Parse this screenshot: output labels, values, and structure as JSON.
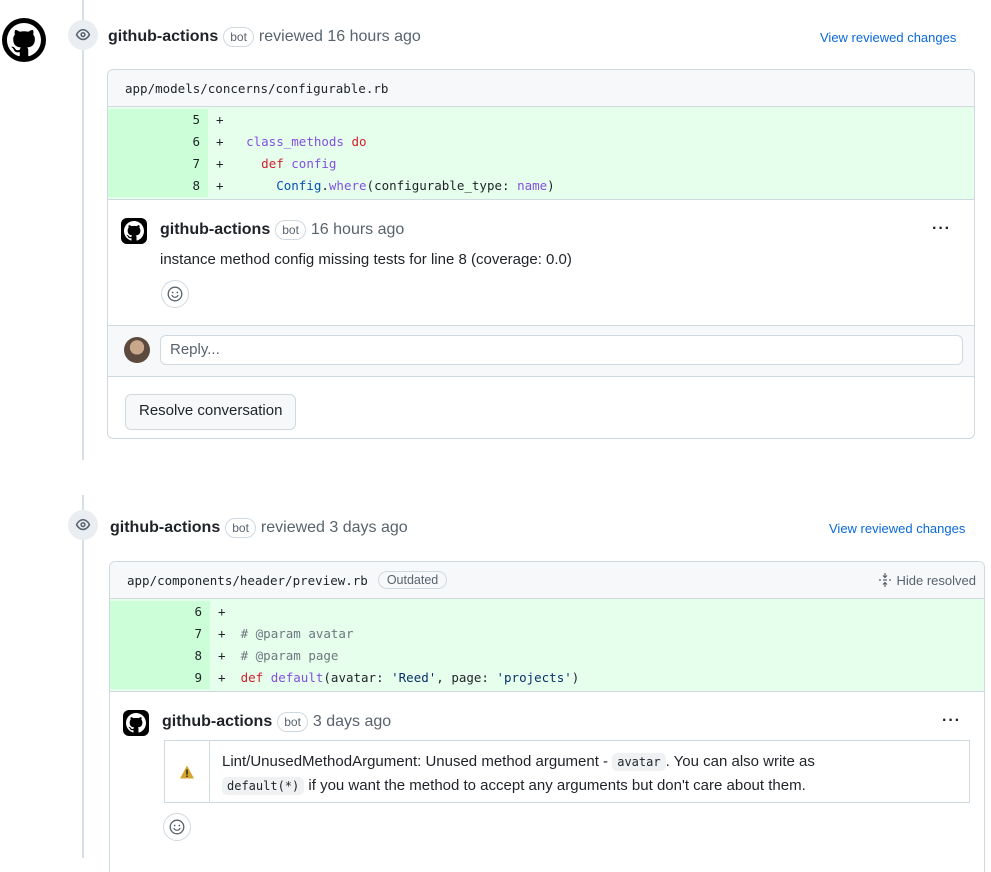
{
  "reviews": [
    {
      "author": "github-actions",
      "badge": "bot",
      "action_time": "reviewed 16 hours ago",
      "view_link": "View reviewed changes",
      "file_path": "app/models/concerns/configurable.rb",
      "diff_lines": [
        {
          "num": "5",
          "sign": "+"
        },
        {
          "num": "6",
          "sign": "+"
        },
        {
          "num": "7",
          "sign": "+"
        },
        {
          "num": "8",
          "sign": "+"
        }
      ],
      "comment": {
        "author": "github-actions",
        "badge": "bot",
        "time": "16 hours ago",
        "more": "···",
        "body": "instance method config missing tests for line 8 (coverage: 0.0)"
      },
      "reply_placeholder": "Reply...",
      "resolve_label": "Resolve conversation"
    },
    {
      "author": "github-actions",
      "badge": "bot",
      "action_time": "reviewed 3 days ago",
      "view_link": "View reviewed changes",
      "file_path": "app/components/header/preview.rb",
      "outdated_label": "Outdated",
      "hide_resolved_label": "Hide resolved",
      "diff_lines": [
        {
          "num": "6",
          "sign": "+"
        },
        {
          "num": "7",
          "sign": "+"
        },
        {
          "num": "8",
          "sign": "+"
        },
        {
          "num": "9",
          "sign": "+"
        }
      ],
      "comment": {
        "author": "github-actions",
        "badge": "bot",
        "time": "3 days ago",
        "more": "···",
        "lint_prefix": "Lint/UnusedMethodArgument: Unused method argument - ",
        "lint_code1": "avatar",
        "lint_middle": ". You can also write as",
        "lint_code2": "default(*)",
        "lint_suffix": " if you want the method to accept any arguments but don't care about them."
      }
    }
  ],
  "code": {
    "r1_l2_a": "class_methods",
    "r1_l2_b": "do",
    "r1_l3_a": "def",
    "r1_l3_b": "config",
    "r1_l4_a": "Config",
    "r1_l4_b": ".",
    "r1_l4_c": "where",
    "r1_l4_d": "(configurable_type: ",
    "r1_l4_e": "name",
    "r1_l4_f": ")",
    "r2_l2": "# @param avatar",
    "r2_l3": "# @param page",
    "r2_l4_a": "def",
    "r2_l4_b": "default",
    "r2_l4_c": "(avatar: ",
    "r2_l4_d": "'Reed'",
    "r2_l4_e": ", page: ",
    "r2_l4_f": "'projects'",
    "r2_l4_g": ")"
  },
  "icons": {
    "eye": "eye-icon",
    "github": "github-mark-icon",
    "smiley": "smiley-icon",
    "warning": "warning-icon",
    "fold": "fold-icon"
  },
  "colors": {
    "link": "#0969da",
    "diff_add": "#e6ffec",
    "diff_add_num": "#ccffd8",
    "border": "#d1d9e0"
  }
}
